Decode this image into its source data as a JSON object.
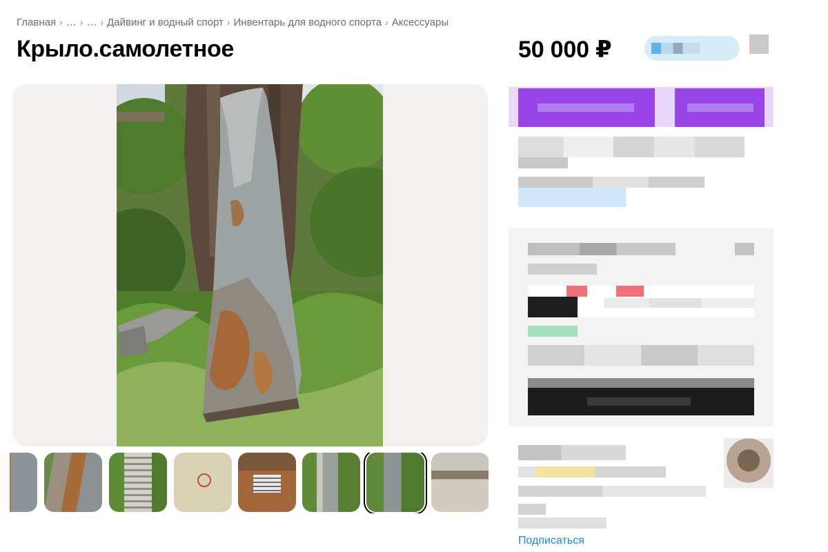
{
  "breadcrumb": {
    "items": [
      "Главная",
      "…",
      "…",
      "Дайвинг и водный спорт",
      "Инвентарь для водного спорта",
      "Аксессуары"
    ],
    "separator": "›"
  },
  "listing": {
    "title": "Крыло.самолетное",
    "price": "50 000 ₽"
  },
  "gallery": {
    "thumbnail_count": 8,
    "selected_thumbnail": 7
  },
  "seller": {
    "subscribe_label": "Подписаться"
  },
  "colors": {
    "link": "#1a8bd6",
    "accent_button": "#9a45e8",
    "gallery_bg": "#f2f1ef"
  }
}
